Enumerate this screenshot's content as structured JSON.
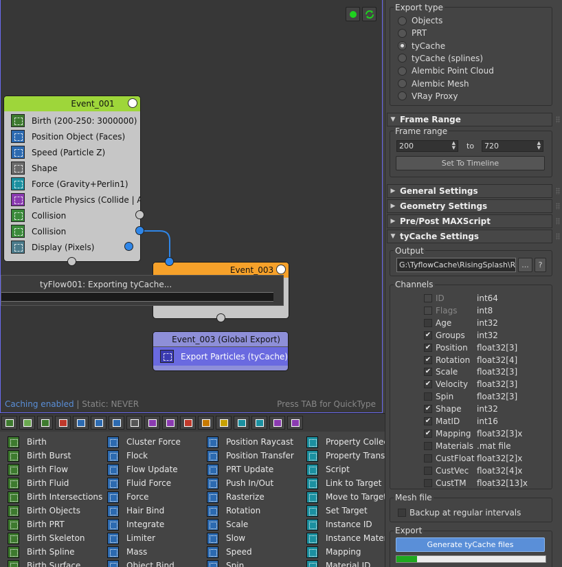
{
  "canvas": {
    "event1": {
      "title": "Event_001",
      "ops": [
        {
          "label": "Birth (200-250: 3000000)",
          "color": "#3d7a2e"
        },
        {
          "label": "Position Object (Faces)",
          "color": "#2c6ab0"
        },
        {
          "label": "Speed (Particle Z)",
          "color": "#2c6ab0"
        },
        {
          "label": "Shape",
          "color": "#6a6a6a"
        },
        {
          "label": "Force (Gravity+Perlin1)",
          "color": "#1b90a0"
        },
        {
          "label": "Particle Physics (Collide | A...",
          "color": "#8a3ab0"
        },
        {
          "label": "Collision",
          "color": "#3a8a3a"
        },
        {
          "label": "Collision",
          "color": "#3a8a3a"
        },
        {
          "label": "Display (Pixels)",
          "color": "#4a7a8a"
        }
      ]
    },
    "event3": {
      "title": "Event_003"
    },
    "global": {
      "title": "Event_003 (Global Export)",
      "op": "Export Particles (tyCache)"
    },
    "progress_text": "tyFlow001: Exporting tyCache...",
    "status": {
      "caching": "Caching enabled",
      "sep": " | ",
      "static": "Static: NEVER"
    },
    "hint": "Press TAB for QuickType"
  },
  "oplist": {
    "col1": [
      "Birth",
      "Birth Burst",
      "Birth Flow",
      "Birth Fluid",
      "Birth Intersections",
      "Birth Objects",
      "Birth PRT",
      "Birth Skeleton",
      "Birth Spline",
      "Birth Surface"
    ],
    "col2": [
      "Cluster Force",
      "Flock",
      "Flow Update",
      "Fluid Force",
      "Force",
      "Hair Bind",
      "Integrate",
      "Limiter",
      "Mass",
      "Object Bind"
    ],
    "col3": [
      "Position Raycast",
      "Position Transfer",
      "PRT Update",
      "Push In/Out",
      "Rasterize",
      "Rotation",
      "Scale",
      "Slow",
      "Speed",
      "Spin"
    ],
    "col4": [
      "Property Collect",
      "Property Transfer",
      "Script",
      "Link to Target",
      "Move to Target",
      "Set Target",
      "Instance ID",
      "Instance Material",
      "Mapping",
      "Material ID"
    ]
  },
  "panel": {
    "export_type": {
      "label": "Export type",
      "options": [
        "Objects",
        "PRT",
        "tyCache",
        "tyCache (splines)",
        "Alembic Point Cloud",
        "Alembic Mesh",
        "VRay Proxy"
      ],
      "selected": "tyCache"
    },
    "frame_range": {
      "title": "Frame Range",
      "label": "Frame range",
      "start": "200",
      "to": "to",
      "end": "720",
      "button": "Set To Timeline"
    },
    "sections": [
      "General Settings",
      "Geometry Settings",
      "Pre/Post MAXScript",
      "tyCache Settings"
    ],
    "output": {
      "label": "Output",
      "path": "G:\\TyflowCache\\RisingSplash\\RisingSplash",
      "browse": "...",
      "help": "?"
    },
    "channels": {
      "label": "Channels",
      "items": [
        {
          "name": "ID",
          "type": "int64",
          "checked": false,
          "enabled": false
        },
        {
          "name": "Flags",
          "type": "int8",
          "checked": false,
          "enabled": false
        },
        {
          "name": "Age",
          "type": "int32",
          "checked": false,
          "enabled": true
        },
        {
          "name": "Groups",
          "type": "int32",
          "checked": true,
          "enabled": true
        },
        {
          "name": "Position",
          "type": "float32[3]",
          "checked": true,
          "enabled": true
        },
        {
          "name": "Rotation",
          "type": "float32[4]",
          "checked": true,
          "enabled": true
        },
        {
          "name": "Scale",
          "type": "float32[3]",
          "checked": true,
          "enabled": true
        },
        {
          "name": "Velocity",
          "type": "float32[3]",
          "checked": true,
          "enabled": true
        },
        {
          "name": "Spin",
          "type": "float32[3]",
          "checked": false,
          "enabled": true
        },
        {
          "name": "Shape",
          "type": "int32",
          "checked": true,
          "enabled": true
        },
        {
          "name": "MatID",
          "type": "int16",
          "checked": true,
          "enabled": true
        },
        {
          "name": "Mapping",
          "type": "float32[3]x",
          "checked": true,
          "enabled": true
        },
        {
          "name": "Materials",
          "type": ".mat file",
          "checked": false,
          "enabled": true
        },
        {
          "name": "CustFloat",
          "type": "float32[2]x",
          "checked": false,
          "enabled": true
        },
        {
          "name": "CustVec",
          "type": "float32[4]x",
          "checked": false,
          "enabled": true
        },
        {
          "name": "CustTM",
          "type": "float32[13]x",
          "checked": false,
          "enabled": true
        }
      ]
    },
    "mesh_file": {
      "label": "Mesh file",
      "backup": "Backup at regular intervals"
    },
    "export": {
      "label": "Export",
      "button": "Generate tyCache files",
      "progress": 0.14
    }
  },
  "colors": {
    "accent": "#6a6af0",
    "event1_header": "#9ed63a",
    "event3_header": "#f6a12a",
    "global_header": "#8e8fd8",
    "port_blue": "#2f86e8",
    "progress_green": "#1fa81f"
  }
}
